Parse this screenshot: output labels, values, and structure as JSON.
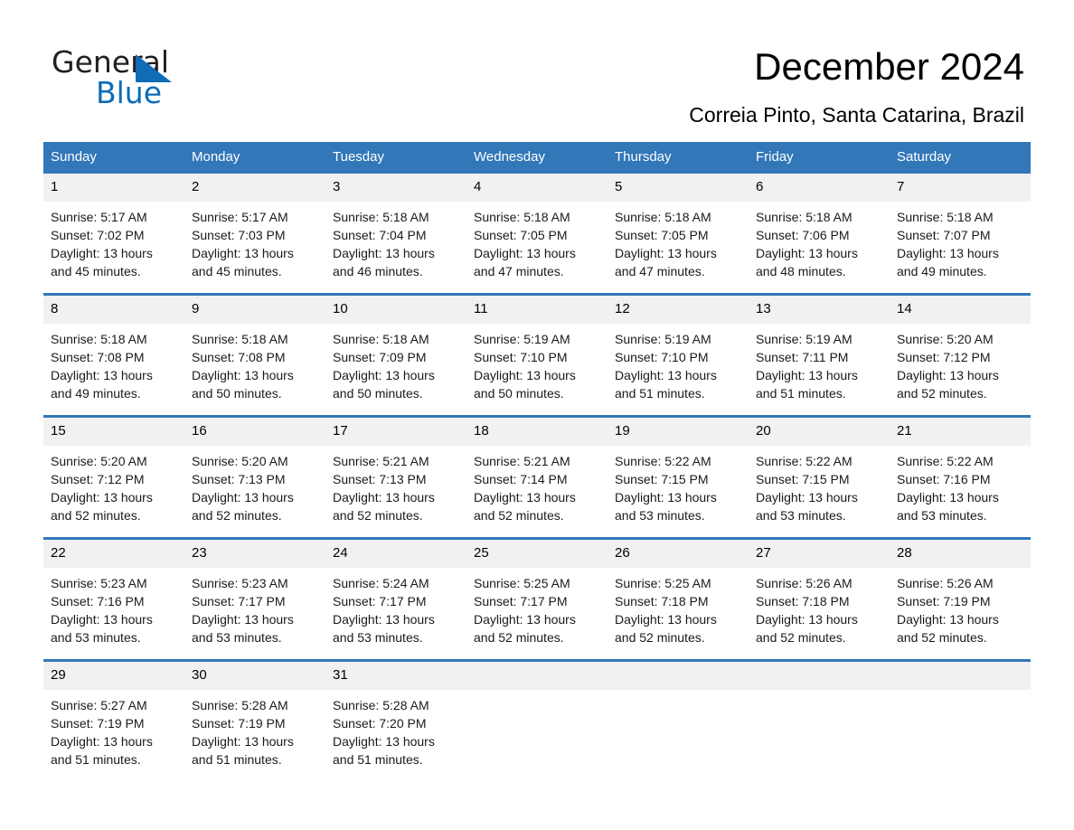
{
  "brand": {
    "name_part1": "General",
    "name_part2": "Blue",
    "logo_icon": "triangle-flag-icon",
    "accent_color": "#0f6cb5"
  },
  "header": {
    "title": "December 2024",
    "subtitle": "Correia Pinto, Santa Catarina, Brazil"
  },
  "colors": {
    "header_blue": "#3277b8",
    "day_band_gray": "#f1f1f1",
    "text": "#000000"
  },
  "weekdays": [
    "Sunday",
    "Monday",
    "Tuesday",
    "Wednesday",
    "Thursday",
    "Friday",
    "Saturday"
  ],
  "labels": {
    "sunrise_prefix": "Sunrise:",
    "sunset_prefix": "Sunset:",
    "daylight_prefix": "Daylight:"
  },
  "weeks": [
    [
      {
        "day": "1",
        "sunrise": "Sunrise: 5:17 AM",
        "sunset": "Sunset: 7:02 PM",
        "daylight_line1": "Daylight: 13 hours",
        "daylight_line2": "and 45 minutes."
      },
      {
        "day": "2",
        "sunrise": "Sunrise: 5:17 AM",
        "sunset": "Sunset: 7:03 PM",
        "daylight_line1": "Daylight: 13 hours",
        "daylight_line2": "and 45 minutes."
      },
      {
        "day": "3",
        "sunrise": "Sunrise: 5:18 AM",
        "sunset": "Sunset: 7:04 PM",
        "daylight_line1": "Daylight: 13 hours",
        "daylight_line2": "and 46 minutes."
      },
      {
        "day": "4",
        "sunrise": "Sunrise: 5:18 AM",
        "sunset": "Sunset: 7:05 PM",
        "daylight_line1": "Daylight: 13 hours",
        "daylight_line2": "and 47 minutes."
      },
      {
        "day": "5",
        "sunrise": "Sunrise: 5:18 AM",
        "sunset": "Sunset: 7:05 PM",
        "daylight_line1": "Daylight: 13 hours",
        "daylight_line2": "and 47 minutes."
      },
      {
        "day": "6",
        "sunrise": "Sunrise: 5:18 AM",
        "sunset": "Sunset: 7:06 PM",
        "daylight_line1": "Daylight: 13 hours",
        "daylight_line2": "and 48 minutes."
      },
      {
        "day": "7",
        "sunrise": "Sunrise: 5:18 AM",
        "sunset": "Sunset: 7:07 PM",
        "daylight_line1": "Daylight: 13 hours",
        "daylight_line2": "and 49 minutes."
      }
    ],
    [
      {
        "day": "8",
        "sunrise": "Sunrise: 5:18 AM",
        "sunset": "Sunset: 7:08 PM",
        "daylight_line1": "Daylight: 13 hours",
        "daylight_line2": "and 49 minutes."
      },
      {
        "day": "9",
        "sunrise": "Sunrise: 5:18 AM",
        "sunset": "Sunset: 7:08 PM",
        "daylight_line1": "Daylight: 13 hours",
        "daylight_line2": "and 50 minutes."
      },
      {
        "day": "10",
        "sunrise": "Sunrise: 5:18 AM",
        "sunset": "Sunset: 7:09 PM",
        "daylight_line1": "Daylight: 13 hours",
        "daylight_line2": "and 50 minutes."
      },
      {
        "day": "11",
        "sunrise": "Sunrise: 5:19 AM",
        "sunset": "Sunset: 7:10 PM",
        "daylight_line1": "Daylight: 13 hours",
        "daylight_line2": "and 50 minutes."
      },
      {
        "day": "12",
        "sunrise": "Sunrise: 5:19 AM",
        "sunset": "Sunset: 7:10 PM",
        "daylight_line1": "Daylight: 13 hours",
        "daylight_line2": "and 51 minutes."
      },
      {
        "day": "13",
        "sunrise": "Sunrise: 5:19 AM",
        "sunset": "Sunset: 7:11 PM",
        "daylight_line1": "Daylight: 13 hours",
        "daylight_line2": "and 51 minutes."
      },
      {
        "day": "14",
        "sunrise": "Sunrise: 5:20 AM",
        "sunset": "Sunset: 7:12 PM",
        "daylight_line1": "Daylight: 13 hours",
        "daylight_line2": "and 52 minutes."
      }
    ],
    [
      {
        "day": "15",
        "sunrise": "Sunrise: 5:20 AM",
        "sunset": "Sunset: 7:12 PM",
        "daylight_line1": "Daylight: 13 hours",
        "daylight_line2": "and 52 minutes."
      },
      {
        "day": "16",
        "sunrise": "Sunrise: 5:20 AM",
        "sunset": "Sunset: 7:13 PM",
        "daylight_line1": "Daylight: 13 hours",
        "daylight_line2": "and 52 minutes."
      },
      {
        "day": "17",
        "sunrise": "Sunrise: 5:21 AM",
        "sunset": "Sunset: 7:13 PM",
        "daylight_line1": "Daylight: 13 hours",
        "daylight_line2": "and 52 minutes."
      },
      {
        "day": "18",
        "sunrise": "Sunrise: 5:21 AM",
        "sunset": "Sunset: 7:14 PM",
        "daylight_line1": "Daylight: 13 hours",
        "daylight_line2": "and 52 minutes."
      },
      {
        "day": "19",
        "sunrise": "Sunrise: 5:22 AM",
        "sunset": "Sunset: 7:15 PM",
        "daylight_line1": "Daylight: 13 hours",
        "daylight_line2": "and 53 minutes."
      },
      {
        "day": "20",
        "sunrise": "Sunrise: 5:22 AM",
        "sunset": "Sunset: 7:15 PM",
        "daylight_line1": "Daylight: 13 hours",
        "daylight_line2": "and 53 minutes."
      },
      {
        "day": "21",
        "sunrise": "Sunrise: 5:22 AM",
        "sunset": "Sunset: 7:16 PM",
        "daylight_line1": "Daylight: 13 hours",
        "daylight_line2": "and 53 minutes."
      }
    ],
    [
      {
        "day": "22",
        "sunrise": "Sunrise: 5:23 AM",
        "sunset": "Sunset: 7:16 PM",
        "daylight_line1": "Daylight: 13 hours",
        "daylight_line2": "and 53 minutes."
      },
      {
        "day": "23",
        "sunrise": "Sunrise: 5:23 AM",
        "sunset": "Sunset: 7:17 PM",
        "daylight_line1": "Daylight: 13 hours",
        "daylight_line2": "and 53 minutes."
      },
      {
        "day": "24",
        "sunrise": "Sunrise: 5:24 AM",
        "sunset": "Sunset: 7:17 PM",
        "daylight_line1": "Daylight: 13 hours",
        "daylight_line2": "and 53 minutes."
      },
      {
        "day": "25",
        "sunrise": "Sunrise: 5:25 AM",
        "sunset": "Sunset: 7:17 PM",
        "daylight_line1": "Daylight: 13 hours",
        "daylight_line2": "and 52 minutes."
      },
      {
        "day": "26",
        "sunrise": "Sunrise: 5:25 AM",
        "sunset": "Sunset: 7:18 PM",
        "daylight_line1": "Daylight: 13 hours",
        "daylight_line2": "and 52 minutes."
      },
      {
        "day": "27",
        "sunrise": "Sunrise: 5:26 AM",
        "sunset": "Sunset: 7:18 PM",
        "daylight_line1": "Daylight: 13 hours",
        "daylight_line2": "and 52 minutes."
      },
      {
        "day": "28",
        "sunrise": "Sunrise: 5:26 AM",
        "sunset": "Sunset: 7:19 PM",
        "daylight_line1": "Daylight: 13 hours",
        "daylight_line2": "and 52 minutes."
      }
    ],
    [
      {
        "day": "29",
        "sunrise": "Sunrise: 5:27 AM",
        "sunset": "Sunset: 7:19 PM",
        "daylight_line1": "Daylight: 13 hours",
        "daylight_line2": "and 51 minutes."
      },
      {
        "day": "30",
        "sunrise": "Sunrise: 5:28 AM",
        "sunset": "Sunset: 7:19 PM",
        "daylight_line1": "Daylight: 13 hours",
        "daylight_line2": "and 51 minutes."
      },
      {
        "day": "31",
        "sunrise": "Sunrise: 5:28 AM",
        "sunset": "Sunset: 7:20 PM",
        "daylight_line1": "Daylight: 13 hours",
        "daylight_line2": "and 51 minutes."
      },
      {
        "day": "",
        "sunrise": "",
        "sunset": "",
        "daylight_line1": "",
        "daylight_line2": ""
      },
      {
        "day": "",
        "sunrise": "",
        "sunset": "",
        "daylight_line1": "",
        "daylight_line2": ""
      },
      {
        "day": "",
        "sunrise": "",
        "sunset": "",
        "daylight_line1": "",
        "daylight_line2": ""
      },
      {
        "day": "",
        "sunrise": "",
        "sunset": "",
        "daylight_line1": "",
        "daylight_line2": ""
      }
    ]
  ]
}
